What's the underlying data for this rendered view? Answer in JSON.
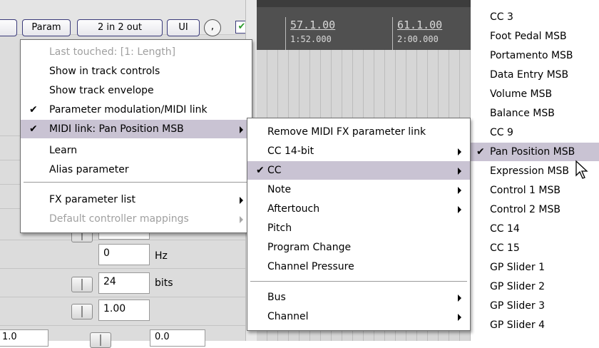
{
  "toolbar": {
    "param_label": "Param",
    "io_label": "2 in 2 out",
    "ui_label": "UI",
    "knob_glyph": ",",
    "checkbox_glyph": "✔"
  },
  "panel": {
    "fields": [
      {
        "value": "0",
        "unit": "Hz"
      },
      {
        "value": "24",
        "unit": "bits"
      },
      {
        "value": "1.00",
        "unit": ""
      }
    ],
    "bottom_left_value": "1.0",
    "bottom_right_value": "0.0"
  },
  "ruler": {
    "marker1_bars": "57.1.00",
    "marker1_time": "1:52.000",
    "marker2_bars": "61.1.00",
    "marker2_time": "2:00.000"
  },
  "param_menu": {
    "items": [
      {
        "label": "Last touched: [1: Length]",
        "checked": false,
        "disabled": true,
        "submenu": false
      },
      {
        "label": "Show in track controls",
        "checked": false,
        "disabled": false,
        "submenu": false
      },
      {
        "label": "Show track envelope",
        "checked": false,
        "disabled": false,
        "submenu": false
      },
      {
        "label": "Parameter modulation/MIDI link",
        "checked": true,
        "disabled": false,
        "submenu": false
      },
      {
        "label": "MIDI link: Pan Position MSB",
        "checked": true,
        "disabled": false,
        "submenu": true,
        "highlighted": true
      },
      {
        "label": "Learn",
        "checked": false,
        "disabled": false,
        "submenu": false
      },
      {
        "label": "Alias parameter",
        "checked": false,
        "disabled": false,
        "submenu": false
      },
      {
        "label": "FX parameter list",
        "checked": false,
        "disabled": false,
        "submenu": true
      },
      {
        "label": "Default controller mappings",
        "checked": false,
        "disabled": true,
        "submenu": true
      }
    ],
    "check_glyph": "✔"
  },
  "midi_menu": {
    "items": [
      {
        "label": "Remove MIDI FX parameter link",
        "submenu": false,
        "checked": false
      },
      {
        "label": "CC 14-bit",
        "submenu": true,
        "checked": false
      },
      {
        "label": "CC",
        "submenu": true,
        "checked": true,
        "highlighted": true
      },
      {
        "label": "Note",
        "submenu": true,
        "checked": false
      },
      {
        "label": "Aftertouch",
        "submenu": true,
        "checked": false
      },
      {
        "label": "Pitch",
        "submenu": false,
        "checked": false
      },
      {
        "label": "Program Change",
        "submenu": false,
        "checked": false
      },
      {
        "label": "Channel Pressure",
        "submenu": false,
        "checked": false
      },
      {
        "label": "Bus",
        "submenu": true,
        "checked": false
      },
      {
        "label": "Channel",
        "submenu": true,
        "checked": false
      }
    ]
  },
  "cc_menu": {
    "items": [
      {
        "label": "CC 3"
      },
      {
        "label": "Foot Pedal MSB"
      },
      {
        "label": "Portamento MSB"
      },
      {
        "label": "Data Entry MSB"
      },
      {
        "label": "Volume MSB"
      },
      {
        "label": "Balance MSB"
      },
      {
        "label": "CC 9"
      },
      {
        "label": "Pan Position MSB",
        "checked": true,
        "highlighted": true
      },
      {
        "label": "Expression MSB"
      },
      {
        "label": "Control 1 MSB"
      },
      {
        "label": "Control 2 MSB"
      },
      {
        "label": "CC 14"
      },
      {
        "label": "CC 15"
      },
      {
        "label": "GP Slider 1"
      },
      {
        "label": "GP Slider 2"
      },
      {
        "label": "GP Slider 3"
      },
      {
        "label": "GP Slider 4"
      }
    ]
  },
  "colors": {
    "highlight": "#c9c3d3",
    "button_border": "#3b3b7a",
    "timeline_bg": "#3c3c3c",
    "checkbox_green": "#2a9a2a"
  }
}
